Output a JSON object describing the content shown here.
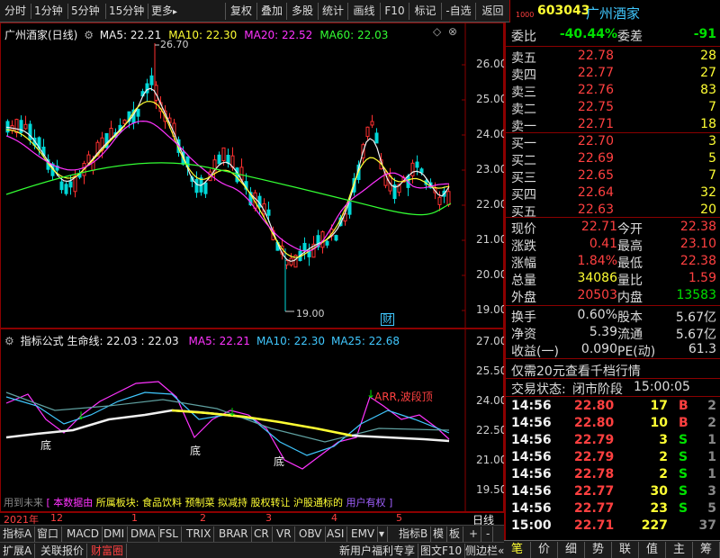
{
  "topbar": {
    "periods": [
      "分时",
      "1分钟",
      "5分钟",
      "15分钟",
      "更多"
    ],
    "more_arrow": "▸",
    "tools": [
      "复权",
      "叠加",
      "多股",
      "统计",
      "画线",
      "F10",
      "标记",
      "-自选",
      "返回"
    ]
  },
  "header": {
    "market_code": "1000",
    "stock_code": "603043",
    "stock_name": "广州酒家"
  },
  "kline": {
    "title": "广州酒家(日线)",
    "ma": [
      {
        "label": "MA5: 22.21",
        "color": "#f0f0f0"
      },
      {
        "label": "MA10: 22.30",
        "color": "#ffff33"
      },
      {
        "label": "MA20: 22.52",
        "color": "#ff33ff"
      },
      {
        "label": "MA60: 22.03",
        "color": "#33ff33"
      }
    ],
    "y_ticks": [
      "26.00",
      "25.00",
      "24.00",
      "23.00",
      "22.00",
      "21.00",
      "20.00",
      "19.00"
    ],
    "high_label": "26.70",
    "low_label": "19.00",
    "cai_label": "财"
  },
  "indicator": {
    "title": "指标公式",
    "line_label": "生命线: 22.03 : 22.03",
    "ma": [
      {
        "label": "MA5: 22.21",
        "color": "#ff33ff"
      },
      {
        "label": "MA10: 22.30",
        "color": "#40c8ff"
      },
      {
        "label": "MA25: 22.68",
        "color": "#40c8ff"
      }
    ],
    "y_ticks": [
      "27.00",
      "25.50",
      "24.00",
      "22.50",
      "21.00",
      "19.50"
    ],
    "signal_label": "ARR,波段顶",
    "bottom_labels": [
      "底",
      "底",
      "底"
    ],
    "footer_gray": "用到未来",
    "footer_yellow": "所属板块: 食品饮料 预制菜 拟减持 股权转让 沪股通标的",
    "footer_magenta": "[ 本数据由",
    "footer_purple": "用户有权 ]"
  },
  "time_axis": {
    "labels": [
      "2021年",
      "12",
      "1",
      "2",
      "3",
      "4",
      "5"
    ],
    "period": "日线"
  },
  "tabs": [
    "指标A",
    "窗口",
    "MACD",
    "DMI",
    "DMA",
    "FSL",
    "TRIX",
    "BRAR",
    "CR",
    "VR",
    "OBV",
    "ASI",
    "EMV",
    "▾",
    "指标B",
    "模",
    "板"
  ],
  "tab_controls": [
    "+",
    "-"
  ],
  "statusbar": {
    "left": [
      "扩展A",
      "关联报价",
      "财富圈"
    ],
    "right": [
      "新用户福利专享",
      "图文F10",
      "侧边栏"
    ],
    "right_arrow": "«"
  },
  "quote": {
    "weibi_label": "委比",
    "weibi_value": "-40.44%",
    "weicha_label": "委差",
    "weicha_value": "-91",
    "sell": [
      {
        "label": "卖五",
        "price": "22.78",
        "vol": "28"
      },
      {
        "label": "卖四",
        "price": "22.77",
        "vol": "27"
      },
      {
        "label": "卖三",
        "price": "22.76",
        "vol": "83"
      },
      {
        "label": "卖二",
        "price": "22.75",
        "vol": "7"
      },
      {
        "label": "卖一",
        "price": "22.71",
        "vol": "18"
      }
    ],
    "buy": [
      {
        "label": "买一",
        "price": "22.70",
        "vol": "3"
      },
      {
        "label": "买二",
        "price": "22.69",
        "vol": "5"
      },
      {
        "label": "买三",
        "price": "22.65",
        "vol": "7"
      },
      {
        "label": "买四",
        "price": "22.64",
        "vol": "32"
      },
      {
        "label": "买五",
        "price": "22.63",
        "vol": "20"
      }
    ],
    "stats": [
      {
        "l1": "现价",
        "v1": "22.71",
        "c1": "red",
        "l2": "今开",
        "v2": "22.38",
        "c2": "red"
      },
      {
        "l1": "涨跌",
        "v1": "0.41",
        "c1": "red",
        "l2": "最高",
        "v2": "23.10",
        "c2": "red"
      },
      {
        "l1": "涨幅",
        "v1": "1.84%",
        "c1": "red",
        "l2": "最低",
        "v2": "22.38",
        "c2": "red"
      },
      {
        "l1": "总量",
        "v1": "34086",
        "c1": "yel",
        "l2": "量比",
        "v2": "1.59",
        "c2": "red"
      },
      {
        "l1": "外盘",
        "v1": "20503",
        "c1": "red",
        "l2": "内盘",
        "v2": "13583",
        "c2": "green"
      }
    ],
    "fund": [
      {
        "l1": "换手",
        "v1": "0.60%",
        "l2": "股本",
        "v2": "5.67亿"
      },
      {
        "l1": "净资",
        "v1": "5.39",
        "l2": "流通",
        "v2": "5.67亿"
      },
      {
        "l1": "收益(一)",
        "v1": "0.090",
        "l2": "PE(动)",
        "v2": "61.3"
      }
    ],
    "promo": "仅需20元查看千档行情",
    "trade_status_label": "交易状态:",
    "trade_status": "闭市阶段",
    "trade_time": "15:00:05",
    "ticks": [
      {
        "t": "14:56",
        "p": "22.80",
        "v": "17",
        "bs": "B",
        "n": "2"
      },
      {
        "t": "14:56",
        "p": "22.80",
        "v": "10",
        "bs": "B",
        "n": "2"
      },
      {
        "t": "14:56",
        "p": "22.79",
        "v": "3",
        "bs": "S",
        "n": "1"
      },
      {
        "t": "14:56",
        "p": "22.79",
        "v": "2",
        "bs": "S",
        "n": "1"
      },
      {
        "t": "14:56",
        "p": "22.78",
        "v": "2",
        "bs": "S",
        "n": "1"
      },
      {
        "t": "14:56",
        "p": "22.77",
        "v": "30",
        "bs": "S",
        "n": "3"
      },
      {
        "t": "14:56",
        "p": "22.77",
        "v": "23",
        "bs": "S",
        "n": "5"
      },
      {
        "t": "15:00",
        "p": "22.71",
        "v": "227",
        "bs": "",
        "n": "37"
      }
    ]
  },
  "right_tabs": [
    "笔",
    "价",
    "细",
    "势",
    "联",
    "值",
    "主",
    "筹"
  ]
}
